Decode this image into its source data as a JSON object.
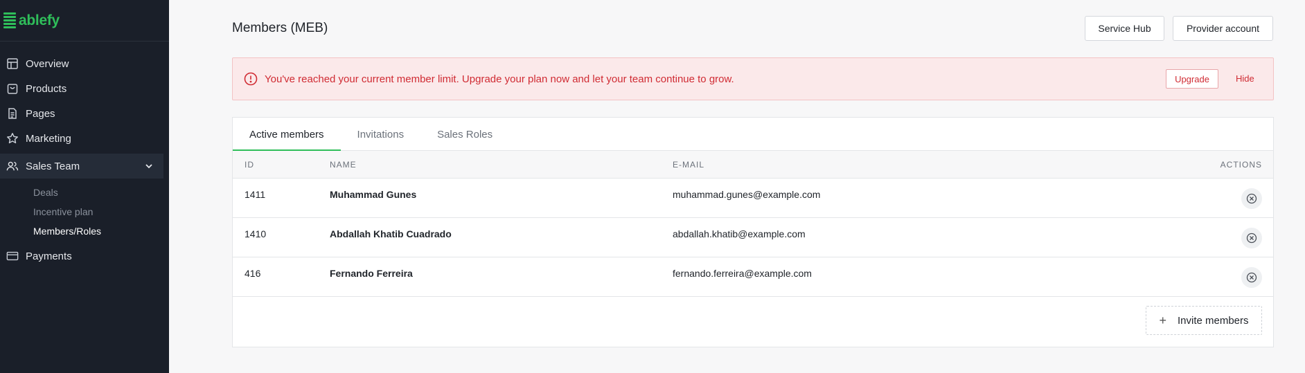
{
  "brand": {
    "name": "ablefy",
    "color": "#2fbe5a"
  },
  "sidebar": {
    "items": [
      {
        "label": "Overview",
        "icon": "layout-icon"
      },
      {
        "label": "Products",
        "icon": "bag-icon"
      },
      {
        "label": "Pages",
        "icon": "file-icon"
      },
      {
        "label": "Marketing",
        "icon": "star-icon"
      },
      {
        "label": "Sales Team",
        "icon": "users-icon",
        "expanded": true,
        "children": [
          {
            "label": "Deals"
          },
          {
            "label": "Incentive plan"
          },
          {
            "label": "Members/Roles",
            "current": true
          }
        ]
      },
      {
        "label": "Payments",
        "icon": "card-icon"
      }
    ]
  },
  "header": {
    "title": "Members (MEB)",
    "service_hub": "Service Hub",
    "provider_account": "Provider account"
  },
  "alert": {
    "message": "You've reached your current member limit. Upgrade your plan now and let your team continue to grow.",
    "upgrade": "Upgrade",
    "hide": "Hide",
    "color": "#d02b33"
  },
  "tabs": [
    {
      "label": "Active members",
      "active": true
    },
    {
      "label": "Invitations"
    },
    {
      "label": "Sales Roles"
    }
  ],
  "table": {
    "columns": [
      "ID",
      "NAME",
      "E-MAIL",
      "ACTIONS"
    ],
    "rows": [
      {
        "id": "1411",
        "name": "Muhammad Gunes",
        "email": "muhammad.gunes@example.com"
      },
      {
        "id": "1410",
        "name": "Abdallah Khatib Cuadrado",
        "email": "abdallah.khatib@example.com"
      },
      {
        "id": "416",
        "name": "Fernando Ferreira",
        "email": "fernando.ferreira@example.com"
      }
    ]
  },
  "invite_label": "Invite members"
}
